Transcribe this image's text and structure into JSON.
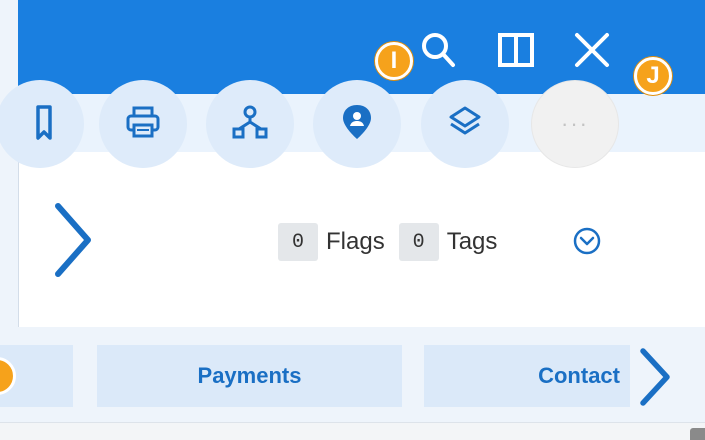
{
  "header": {
    "icons": [
      "search-icon",
      "split-view-icon",
      "close-icon"
    ]
  },
  "toolbar": {
    "buttons": [
      "bookmark-icon",
      "print-icon",
      "hierarchy-icon",
      "location-icon",
      "layers-icon",
      "more-icon"
    ],
    "more_label": "···"
  },
  "badges": {
    "i": "I",
    "j": "J"
  },
  "meta": {
    "flags_count": "0",
    "flags_label": "Flags",
    "tags_count": "0",
    "tags_label": "Tags"
  },
  "tabs": {
    "payments": "Payments",
    "contact": "Contact"
  },
  "colors": {
    "header_blue": "#1a7fe0",
    "icon_blue": "#1a6fc4",
    "badge_orange": "#f6a21b"
  }
}
